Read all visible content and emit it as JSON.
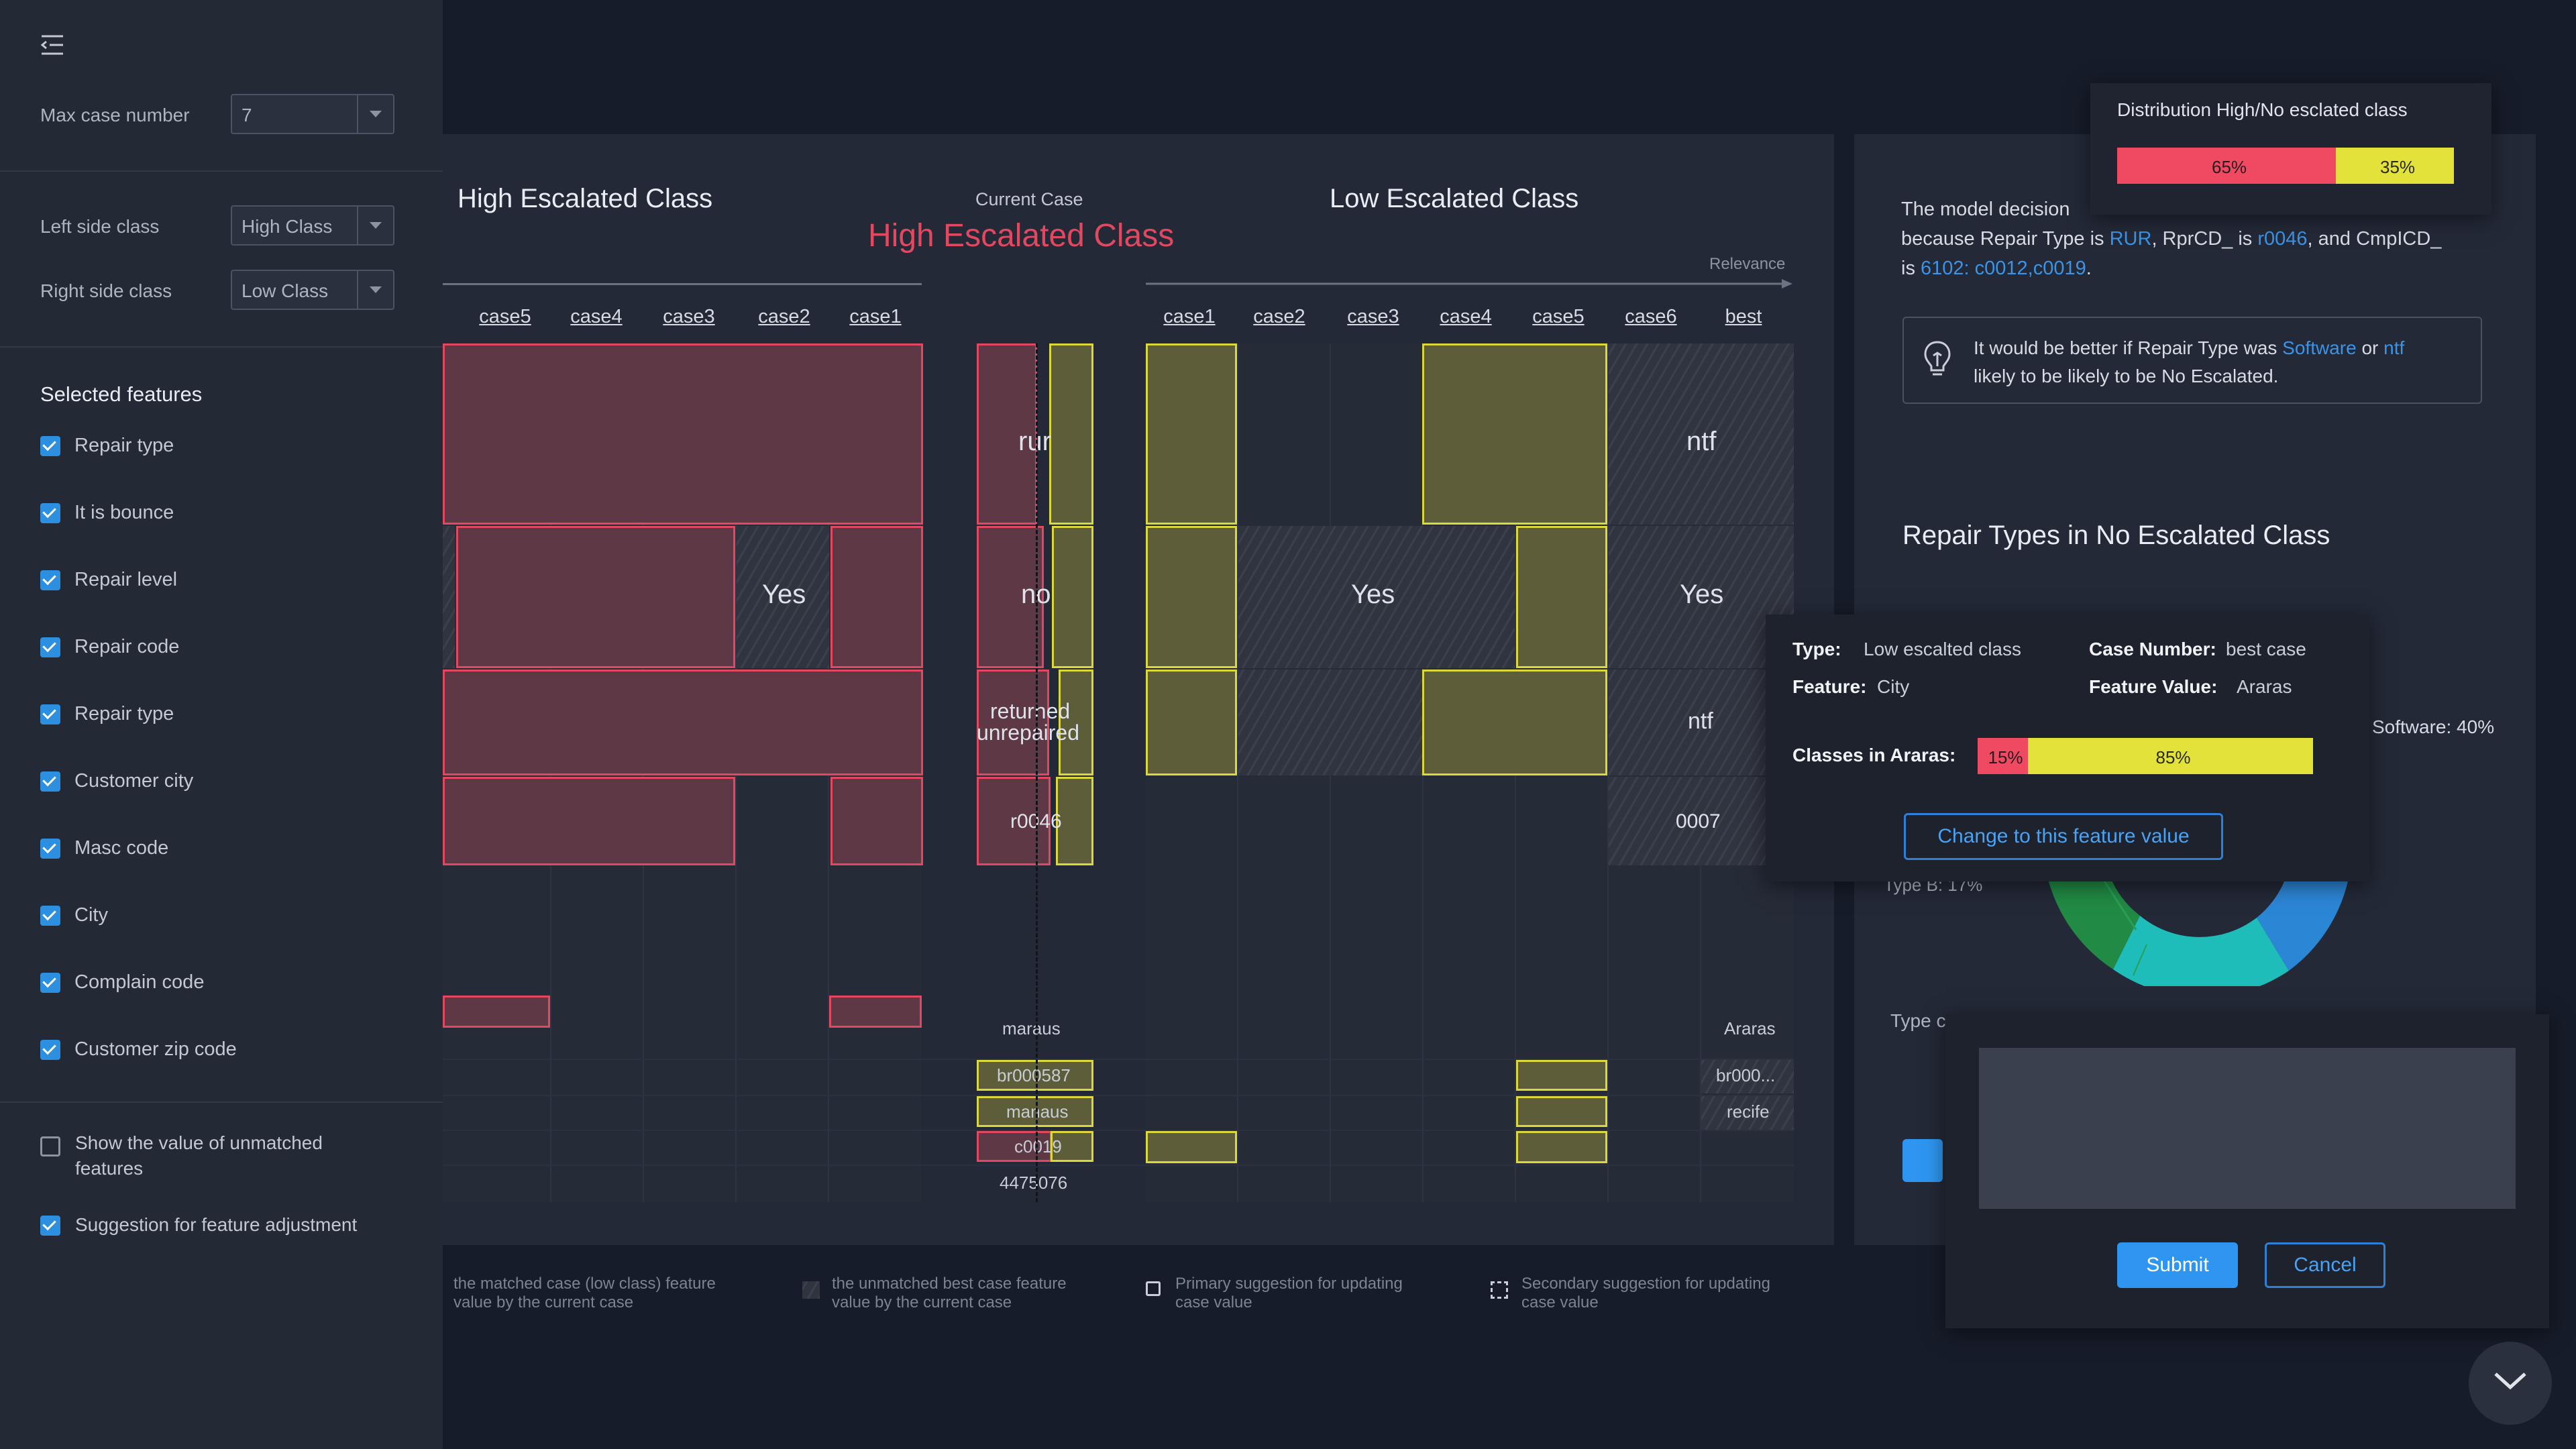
{
  "sidebar": {
    "max_case_label": "Max case number",
    "max_case_value": "7",
    "left_class_label": "Left side class",
    "left_class_value": "High Class",
    "right_class_label": "Right side class",
    "right_class_value": "Low Class",
    "selected_features_title": "Selected features",
    "features": [
      {
        "label": "Repair type",
        "checked": true
      },
      {
        "label": "It is bounce",
        "checked": true
      },
      {
        "label": "Repair level",
        "checked": true
      },
      {
        "label": "Repair code",
        "checked": true
      },
      {
        "label": "Repair type",
        "checked": true
      },
      {
        "label": "Customer city",
        "checked": true
      },
      {
        "label": "Masc code",
        "checked": true
      },
      {
        "label": "City",
        "checked": true
      },
      {
        "label": "Complain code",
        "checked": true
      },
      {
        "label": "Customer zip code",
        "checked": true
      }
    ],
    "show_unmatched_label_1": "Show the value of unmatched",
    "show_unmatched_label_2": "features",
    "suggestion_label": "Suggestion for feature adjustment"
  },
  "main": {
    "left_title": "High Escalated Class",
    "current_case_label": "Current Case",
    "current_case_class": "High Escalated Class",
    "right_title": "Low Escalated Class",
    "relevance_label": "Relevance",
    "left_cases": [
      "case5",
      "case4",
      "case3",
      "case2",
      "case1"
    ],
    "right_cases": [
      "case1",
      "case2",
      "case3",
      "case4",
      "case5",
      "case6",
      "best"
    ],
    "current_values": [
      "rur",
      "no",
      "returned",
      "unrepaired",
      "r0046",
      "maraus",
      "br000587",
      "manaus",
      "c0019",
      "4475076"
    ],
    "left_yes": "Yes",
    "right_values": [
      "Yes",
      "ntf",
      "Yes",
      "ntf",
      "0007",
      "Araras",
      "br000...",
      "recife"
    ],
    "legend": {
      "matched_1": "the matched case (low class) feature",
      "matched_2": "value by the current case",
      "unmatched_1": "the unmatched best case feature",
      "unmatched_2": "value by the current case",
      "primary_1": "Primary suggestion for updating",
      "primary_2": "case value",
      "secondary_1": "Secondary suggestion for updating",
      "secondary_2": "case value"
    }
  },
  "right": {
    "distribution_title": "Distribution High/No esclated class",
    "dist_high_pct": "65%",
    "dist_low_pct": "35%",
    "dist_high_value": 0.65,
    "decision_line1": "The model decision",
    "decision_line2_pre": "because Repair Type is ",
    "decision_rur": "RUR",
    "decision_line2_mid": ", RprCD_ is ",
    "decision_r0046": "r0046",
    "decision_line2_post": ", and CmpICD_",
    "decision_line3_pre": "is ",
    "decision_codes": "6102: c0012,c0019",
    "decision_line3_post": ".",
    "suggest_pre": "It would be better if Repair Type was ",
    "suggest_software": "Software",
    "suggest_or": " or ",
    "suggest_ntf": "ntf",
    "suggest_line2": "likely to be likely to be No Escalated.",
    "repair_types_title": "Repair Types in No Escalated Class",
    "software_label": "Software: 40%",
    "type_b_label": "Type B: 17%",
    "type_label_partial": "Type с"
  },
  "tooltip": {
    "type_key": "Type:",
    "type_val": "Low escalted class",
    "case_key": "Case Number:",
    "case_val": "best case",
    "feature_key": "Feature:",
    "feature_val": "City",
    "fvalue_key": "Feature Value:",
    "fvalue_val": "Araras",
    "classes_label": "Classes in Araras:",
    "pct_high": "15%",
    "pct_low": "85%",
    "high_value": 0.15,
    "change_button": "Change to this feature value"
  },
  "dialog": {
    "submit": "Submit",
    "cancel": "Cancel"
  },
  "colors": {
    "high": "#e2485f",
    "low": "#dcd839",
    "accent": "#2e96f0",
    "background": "#161c29"
  }
}
